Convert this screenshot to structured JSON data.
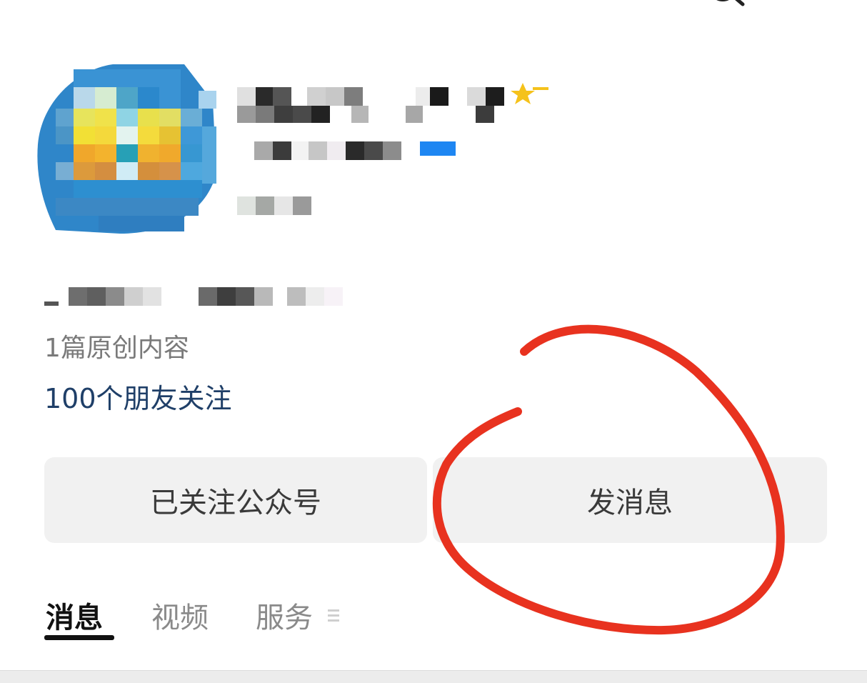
{
  "profile": {
    "article_count": "1篇原创内容",
    "friends_following": "100个朋友关注"
  },
  "actions": {
    "followed_label": "已关注公众号",
    "send_message_label": "发消息"
  },
  "tabs": [
    {
      "label": "消息",
      "active": true
    },
    {
      "label": "视频",
      "active": false
    },
    {
      "label": "服务",
      "active": false
    }
  ],
  "icons": {
    "back": "back-icon",
    "search": "search-icon",
    "verified_star": "star-icon",
    "menu": "menu-icon"
  },
  "colors": {
    "link_text": "#1f3f68",
    "annotation_circle": "#e8321f",
    "star": "#f5c21b",
    "button_bg": "#f1f1f1"
  }
}
